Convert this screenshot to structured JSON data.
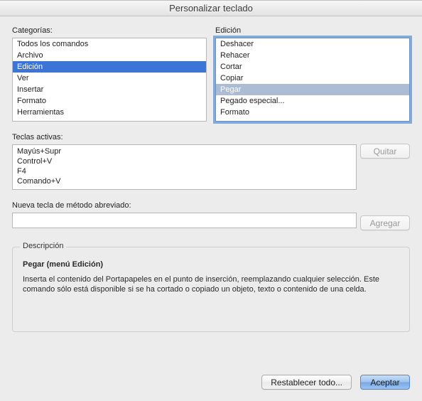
{
  "window": {
    "title": "Personalizar teclado"
  },
  "categories": {
    "label": "Categorías:",
    "items": [
      "Todos los comandos",
      "Archivo",
      "Edición",
      "Ver",
      "Insertar",
      "Formato",
      "Herramientas"
    ],
    "selectedIndex": 2
  },
  "commands": {
    "label": "Edición",
    "items": [
      "Deshacer",
      "Rehacer",
      "Cortar",
      "Copiar",
      "Pegar",
      "Pegado especial...",
      "Formato"
    ],
    "selectedIndex": 4
  },
  "activeKeys": {
    "label": "Teclas activas:",
    "items": [
      "Mayús+Supr",
      "Control+V",
      "F4",
      "Comando+V"
    ]
  },
  "newKey": {
    "label": "Nueva tecla de método abreviado:",
    "value": ""
  },
  "buttons": {
    "remove": "Quitar",
    "add": "Agregar",
    "resetAll": "Restablecer todo...",
    "accept": "Aceptar"
  },
  "description": {
    "legend": "Descripción",
    "title": "Pegar (menú Edición)",
    "body": "Inserta el contenido del Portapapeles en el punto de inserción, reemplazando cualquier selección. Este comando sólo está disponible si se ha cortado o copiado un objeto, texto o contenido de una celda."
  }
}
